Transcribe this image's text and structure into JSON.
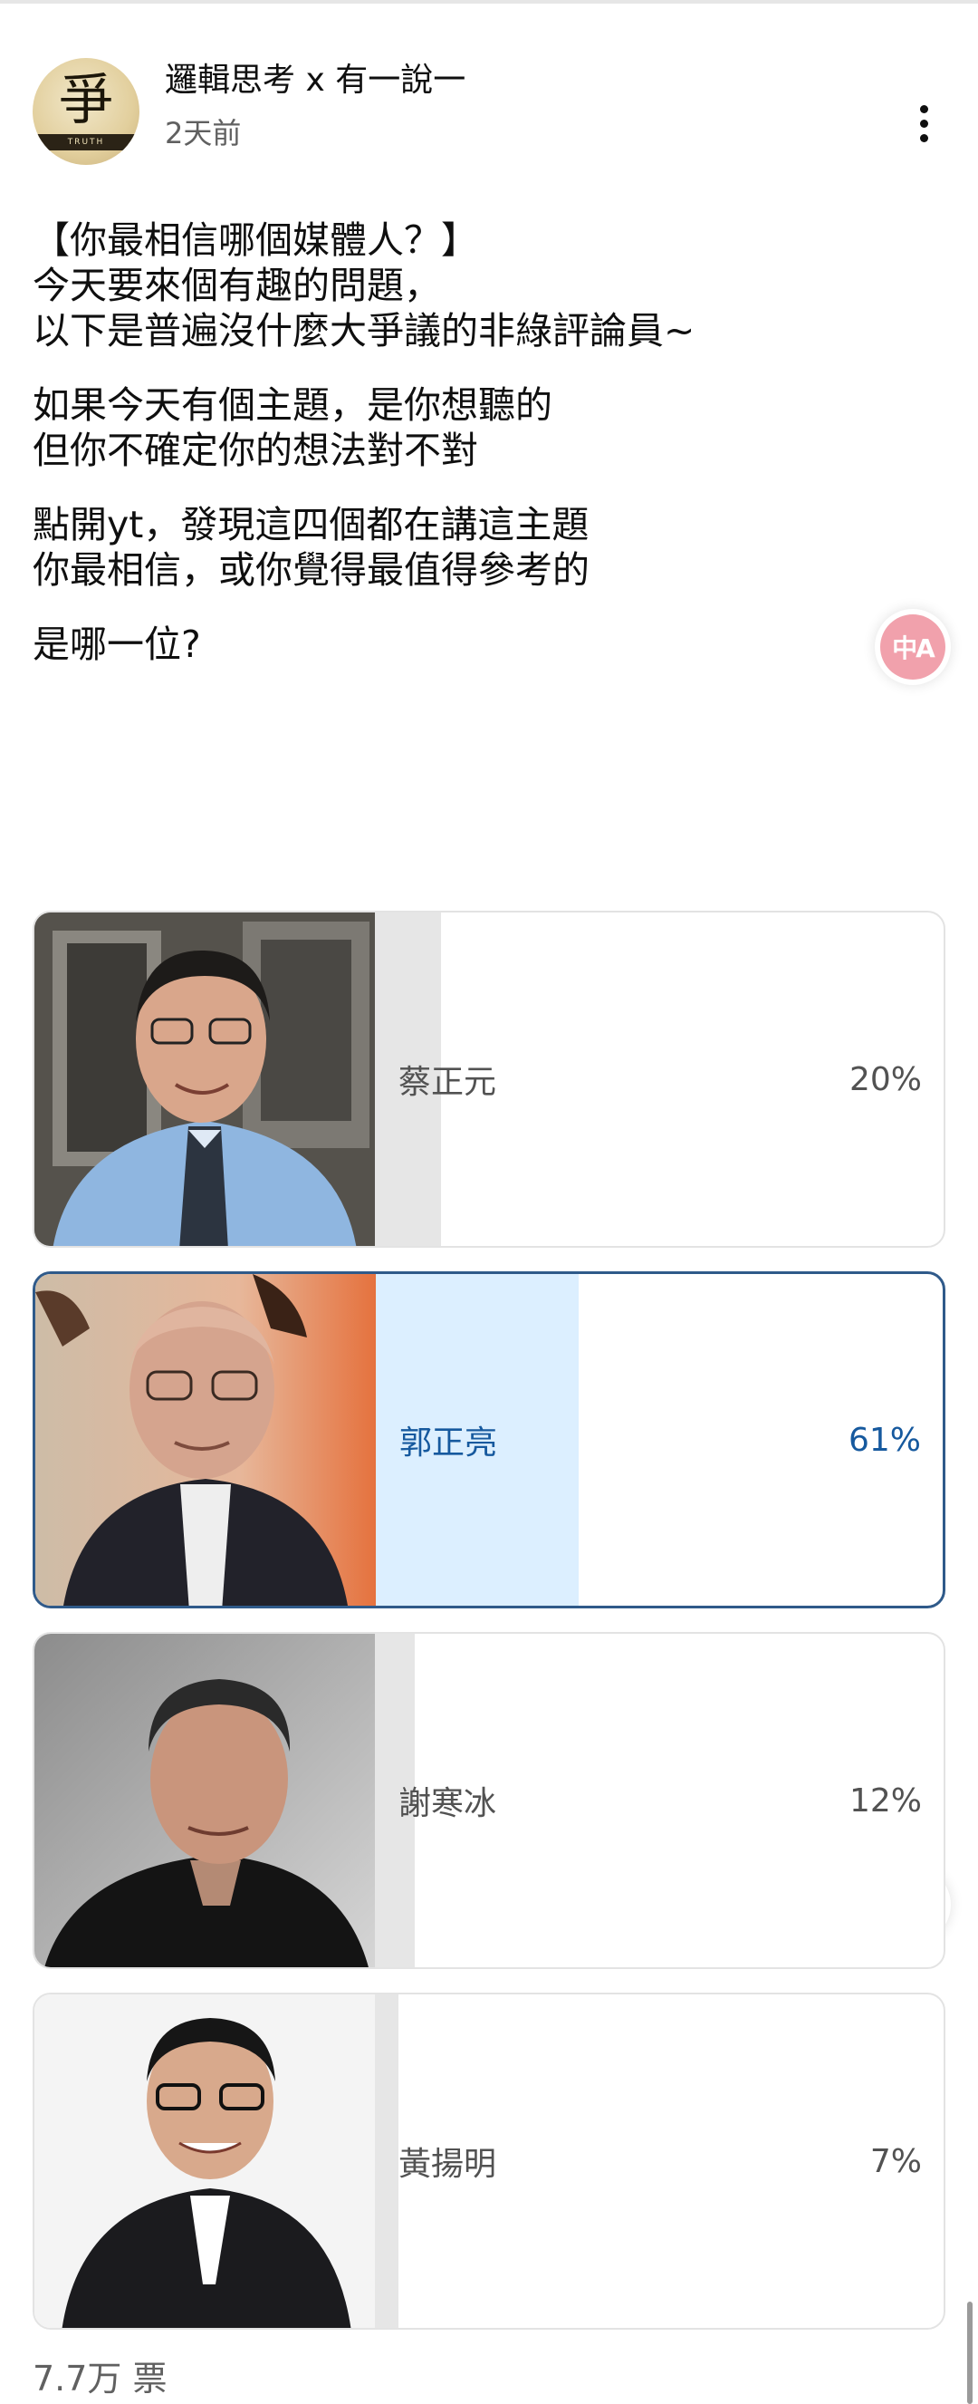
{
  "post": {
    "channel_name": "邏輯思考 x 有一說一",
    "time": "2天前",
    "avatar_glyph": "爭",
    "avatar_band": "TRUTH",
    "lines": [
      "【你最相信哪個媒體人？】",
      "今天要來個有趣的問題，",
      "以下是普遍沒什麼大爭議的非綠評論員~",
      "",
      "如果今天有個主題，是你想聽的",
      "但你不確定你的想法對不對",
      "",
      "點開yt，發現這四個都在講這主題",
      "你最相信，或你覺得最值得參考的",
      "",
      "是哪一位?"
    ]
  },
  "poll": {
    "options": [
      {
        "name": "蔡正元",
        "percent": "20%",
        "fraction": 0.2,
        "selected": false
      },
      {
        "name": "郭正亮",
        "percent": "61%",
        "fraction": 0.61,
        "selected": true
      },
      {
        "name": "謝寒冰",
        "percent": "12%",
        "fraction": 0.12,
        "selected": false
      },
      {
        "name": "黃揚明",
        "percent": "7%",
        "fraction": 0.07,
        "selected": false
      }
    ],
    "vote_count": "7.7万 票"
  },
  "translate_button": {
    "glyph": "中A",
    "icon": "translate-icon"
  },
  "colors": {
    "selected_border": "#2f5a8a",
    "selected_bar": "#dcefff",
    "selected_text": "#16599e",
    "unselected_bar": "#e6e6e6",
    "translate_bg": "#f1a1ac"
  }
}
